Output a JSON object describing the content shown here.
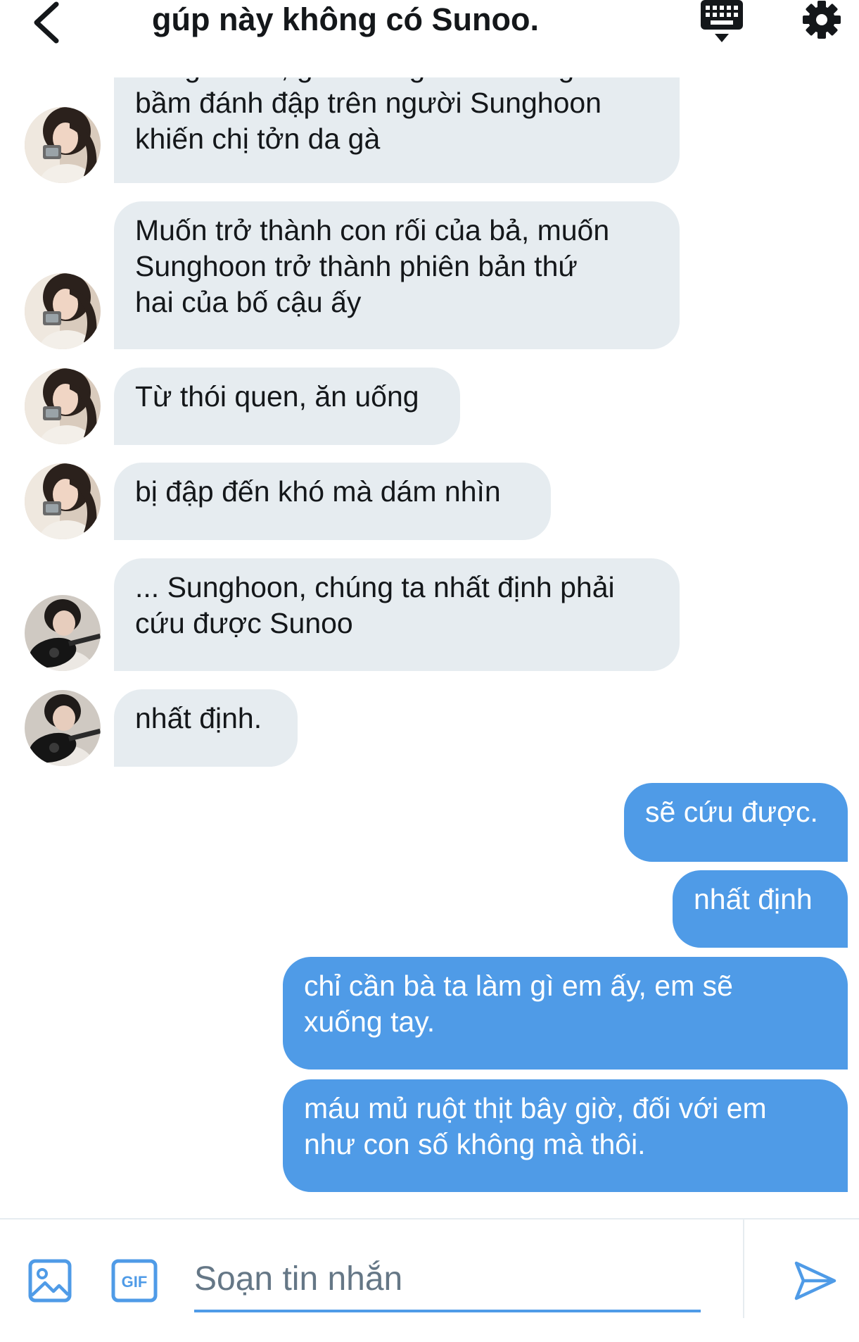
{
  "header": {
    "back_icon": "chevron-left-icon",
    "title": "gúp này không có Sunoo.",
    "keyboard_icon": "keyboard-icon",
    "settings_icon": "gear-icon"
  },
  "messages": [
    {
      "direction": "in",
      "avatar": "avatar-girl",
      "text": "đời giữ con, giữ chồng. Nhìn dòng vết\nbầm đánh đập trên người Sunghoon\nkhiến chị tởn da gà"
    },
    {
      "direction": "in",
      "avatar": "avatar-girl",
      "text": "Muốn trở thành con rối của bả, muốn\nSunghoon trở thành phiên bản thứ\nhai của bố cậu ấy"
    },
    {
      "direction": "in",
      "avatar": "avatar-girl",
      "text": "Từ thói quen, ăn uống"
    },
    {
      "direction": "in",
      "avatar": "avatar-girl",
      "text": "bị đập đến khó mà dám nhìn"
    },
    {
      "direction": "in",
      "avatar": "avatar-boy-guitar",
      "text": "... Sunghoon, chúng ta nhất định phải\ncứu được Sunoo"
    },
    {
      "direction": "in",
      "avatar": "avatar-boy-guitar",
      "text": "nhất định."
    },
    {
      "direction": "out",
      "text": "sẽ cứu được."
    },
    {
      "direction": "out",
      "text": "nhất định"
    },
    {
      "direction": "out",
      "text": "chỉ cần bà ta làm gì em ấy, em sẽ\nxuống tay."
    },
    {
      "direction": "out",
      "text": "máu mủ ruột thịt bây giờ, đối với em\nnhư con số không mà thôi."
    }
  ],
  "composer": {
    "image_icon": "image-icon",
    "gif_icon": "gif-icon",
    "gif_label": "GIF",
    "placeholder": "Soạn tin nhắn",
    "send_icon": "send-icon"
  },
  "colors": {
    "incoming_bubble": "#e6ecf0",
    "outgoing_bubble": "#4f9be7",
    "accent": "#4f9be7",
    "text": "#14171a"
  }
}
